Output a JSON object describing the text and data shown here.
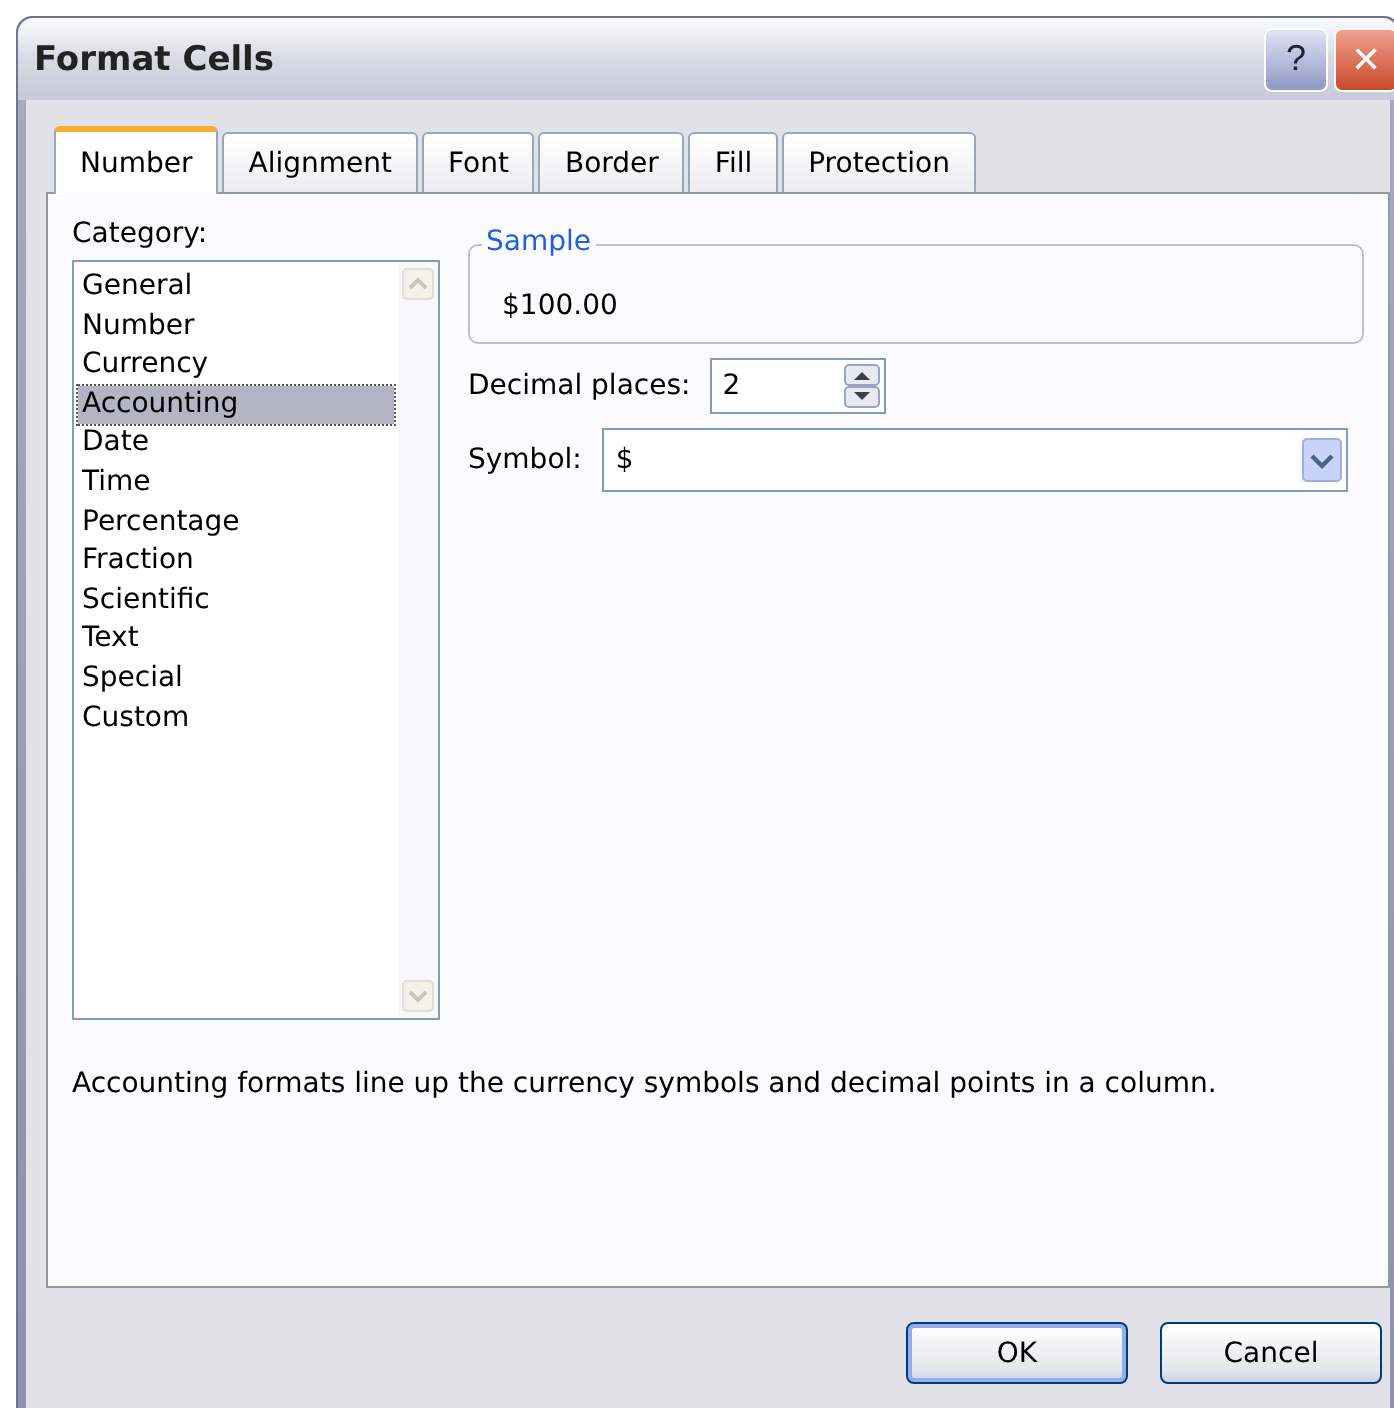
{
  "window": {
    "title": "Format Cells",
    "help": "?",
    "close": "✕"
  },
  "tabs": [
    {
      "label": "Number",
      "selected": true
    },
    {
      "label": "Alignment",
      "selected": false
    },
    {
      "label": "Font",
      "selected": false
    },
    {
      "label": "Border",
      "selected": false
    },
    {
      "label": "Fill",
      "selected": false
    },
    {
      "label": "Protection",
      "selected": false
    }
  ],
  "category": {
    "label": "Category:",
    "items": [
      {
        "label": "General",
        "selected": false
      },
      {
        "label": "Number",
        "selected": false
      },
      {
        "label": "Currency",
        "selected": false
      },
      {
        "label": "Accounting",
        "selected": true
      },
      {
        "label": "Date",
        "selected": false
      },
      {
        "label": "Time",
        "selected": false
      },
      {
        "label": "Percentage",
        "selected": false
      },
      {
        "label": "Fraction",
        "selected": false
      },
      {
        "label": "Scientific",
        "selected": false
      },
      {
        "label": "Text",
        "selected": false
      },
      {
        "label": "Special",
        "selected": false
      },
      {
        "label": "Custom",
        "selected": false
      }
    ]
  },
  "sample": {
    "label": "Sample",
    "value": "$100.00"
  },
  "decimal_places": {
    "label": "Decimal places:",
    "value": "2"
  },
  "symbol": {
    "label": "Symbol:",
    "value": "$"
  },
  "description": "Accounting formats line up the currency symbols and decimal points in a column.",
  "buttons": [
    "OK",
    "Cancel"
  ]
}
